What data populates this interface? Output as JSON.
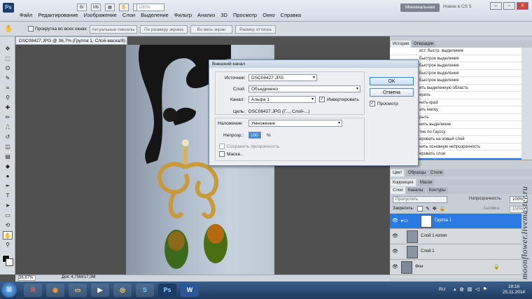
{
  "app": {
    "logo": "Ps",
    "zoom": "100%"
  },
  "menu": [
    "Файл",
    "Редактирование",
    "Изображение",
    "Слои",
    "Выделение",
    "Фильтр",
    "Анализ",
    "3D",
    "Просмотр",
    "Окно",
    "Справка"
  ],
  "workspace": {
    "active": "Минимальная",
    "other": "Новое в CS 5"
  },
  "options": {
    "scroll_all": "Прокрутка во всех окнах",
    "actual_pixels": "Актуальные пикселы",
    "fit_screen": "По размеру экрана",
    "fill_screen": "Во весь экран",
    "print_size": "Размер оттиска"
  },
  "document": {
    "tab_title": "DSC08427.JPG @ 36,7% (Группа 1, Слой-маска/8) *",
    "zoom": "36,67%",
    "doc_size": "Док: 4,75M/17,3M"
  },
  "history": {
    "tabs": [
      "История",
      "Операции"
    ],
    "items": [
      "ист. быстр. выделение",
      "Быстрое выделение",
      "Быстрое выделение",
      "Быстрое выделение",
      "Быстрое выделение",
      "ить выделенную область",
      "ирить",
      "нить край",
      "ать маску",
      "рыть",
      "нить выделение",
      "тие по Гауссу",
      "ировать на новый слой",
      "нить основную непрозрачность",
      "ировать слои",
      "ить слой-маску"
    ],
    "selected_index": 15
  },
  "color_tabs": [
    "Цвет",
    "Образцы",
    "Стили"
  ],
  "corr_tabs": [
    "Коррекция",
    "Маски"
  ],
  "layers_tabs": [
    "Слои",
    "Каналы",
    "Контуры"
  ],
  "layers": {
    "blend_mode": "Пропустить",
    "opacity_label": "Непрозрачность:",
    "opacity": "100%",
    "lock_label": "Закрепить:",
    "fill_label": "Заливка:",
    "fill": "100%",
    "items": [
      {
        "name": "Группа 1",
        "selected": true
      },
      {
        "name": "Слой 1 копия",
        "selected": false
      },
      {
        "name": "Слой 1",
        "selected": false
      },
      {
        "name": "Фон",
        "selected": false
      }
    ]
  },
  "dialog": {
    "title": "Внешний канал",
    "source_label": "Источник:",
    "source_value": "DSC08427.JPG",
    "layer_label": "Слой:",
    "layer_value": "Объединено",
    "channel_label": "Канал:",
    "channel_value": "Альфа 1",
    "invert_label": "Инвертировать",
    "target_label": "Цель:",
    "target_value": "DSC08427.JPG (Г..., Слой-...)",
    "blending_label": "Наложение:",
    "blending_value": "Умножение",
    "opacity_label": "Непрозр.:",
    "opacity_value": "100",
    "opacity_unit": "%",
    "preserve_label": "Сохранить прозрачность",
    "mask_label": "Маска...",
    "ok": "OK",
    "cancel": "Отмена",
    "preview_label": "Просмотр"
  },
  "taskbar": {
    "lang": "RU",
    "time": "18:16",
    "date": "25.11.2014"
  },
  "watermark": "moonflower.livemaster.ru"
}
